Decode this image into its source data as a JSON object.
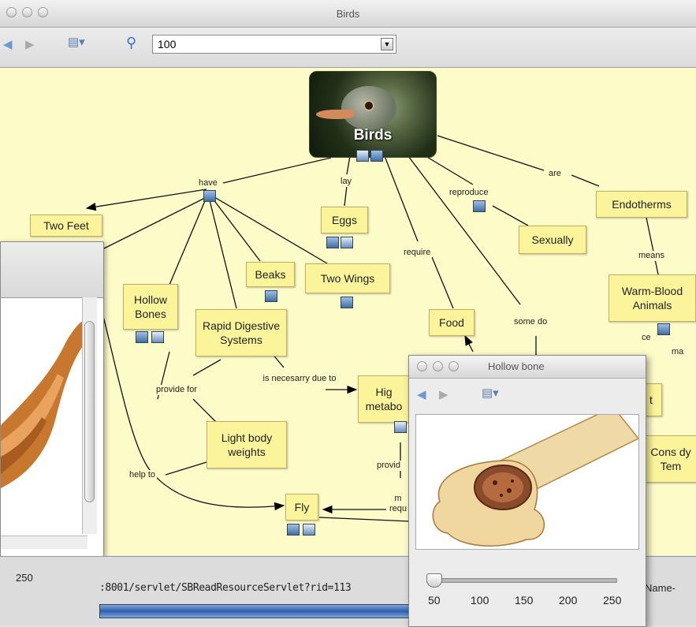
{
  "window": {
    "title": "Birds"
  },
  "toolbar": {
    "zoom_value": "100"
  },
  "concepts": {
    "birds": "Birds",
    "two_feet": "Two Feet",
    "eggs": "Eggs",
    "beaks": "Beaks",
    "two_wings": "Two Wings",
    "hollow_bones": "Hollow Bones",
    "rapid_digestive": "Rapid Digestive Systems",
    "food": "Food",
    "sexually": "Sexually",
    "endotherms": "Endotherms",
    "warm_blooded": "Warm-Blood Animals",
    "higher_metabolism": "Hig metabo",
    "light_body": "Light body weights",
    "fly": "Fly",
    "t_fragment": "t",
    "cons_fragment": "Cons dy Tem"
  },
  "links": {
    "have": "have",
    "lay": "lay",
    "reproduce": "reproduce",
    "are": "are",
    "require": "require",
    "means": "means",
    "some_do": "some do",
    "is_necessary": "is necesarry due to",
    "provide_for": "provide for",
    "help_to": "help to",
    "provid": "provid",
    "m_requ": "m requ",
    "ce": "ce",
    "ma": "ma"
  },
  "bone_window": {
    "title": "Hollow bone",
    "slider_ticks": [
      "50",
      "100",
      "150",
      "200",
      "250"
    ],
    "slider_value": 50
  },
  "left_window": {
    "tick_250": "250"
  },
  "status": {
    "url": ":8001/servlet/SBReadResourceServlet?rid=113",
    "name_label": "Name-"
  }
}
